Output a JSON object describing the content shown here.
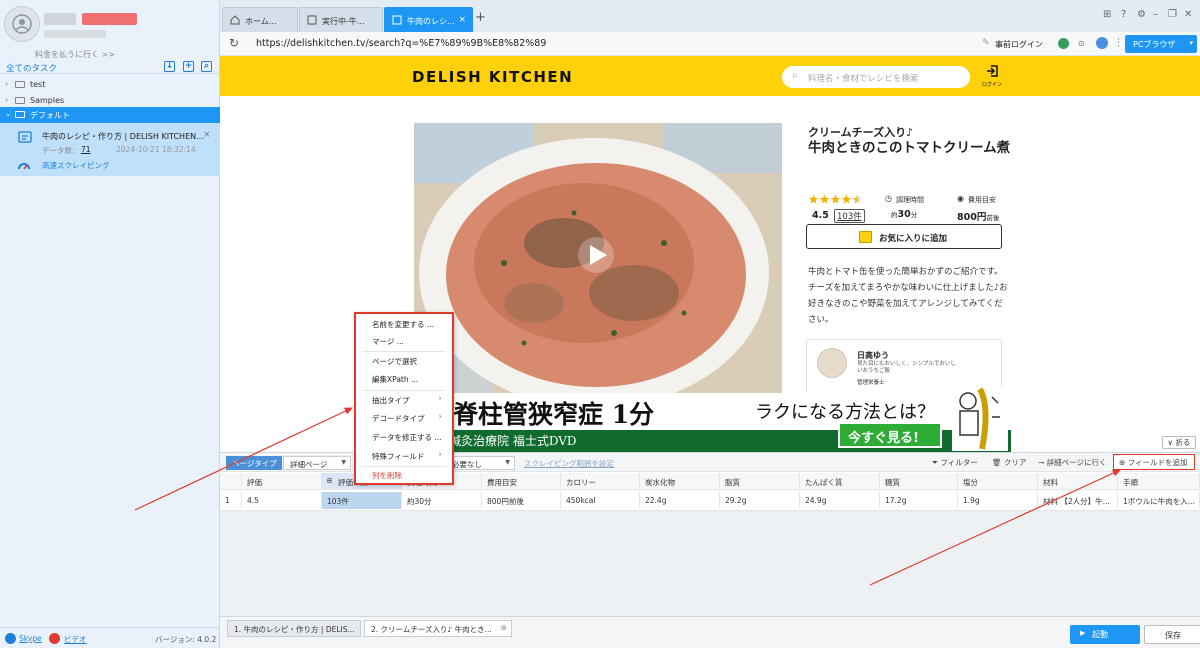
{
  "sidebar": {
    "pay_link": "料金を払うに行く >>",
    "all_tasks": "全てのタスク",
    "folders": [
      {
        "name": "test"
      },
      {
        "name": "Samples"
      },
      {
        "name": "デフォルト"
      }
    ],
    "task": {
      "title": "牛肉のレシピ・作り方 | DELISH KITCHEN...",
      "data_count_label": "データ数:",
      "data_count": "71",
      "date": "2024-10-21 18:32:14",
      "mode": "高速スクレイピング"
    },
    "footer": {
      "skype": "Skype",
      "video": "ビデオ",
      "version": "バージョン: 4.0.2"
    }
  },
  "tabs": [
    {
      "label": "ホーム..."
    },
    {
      "label": "実行中-牛..."
    },
    {
      "label": "牛肉のレシ..."
    }
  ],
  "address": {
    "url": "https://delishkitchen.tv/search?q=%E7%89%9B%E8%82%89",
    "pre_login": "事前ログイン",
    "browser_button": "PCブラウザ"
  },
  "site": {
    "logo": "DELISH KITCHEN",
    "search_placeholder": "料理名・食材でレシピを検索",
    "login_label": "ログイン",
    "recipe_subtitle": "クリームチーズ入り♪",
    "recipe_title": "牛肉ときのこのトマトクリーム煮",
    "rating": "4.5",
    "rating_value": 4.5,
    "rating_count": "103件",
    "cook_time_label": "調理時間",
    "cook_time_prefix": "約",
    "cook_time_value": "30",
    "cook_time_unit": "分",
    "cost_label": "費用目安",
    "cost_value": "800",
    "cost_unit": "円",
    "cost_suffix": "前後",
    "fav_button": "お気に入りに追加",
    "description": "牛肉とトマト缶を使った簡単おかずのご紹介です。チーズを加えてまろやかな味わいに仕上げました♪お好きなきのこや野菜を加えてアレンジしてみてください。",
    "author_name": "日高ゆう",
    "author_desc": "見た目にもおいしく、シンプルでおいしいおうちご飯",
    "author_role": "管理栄養士",
    "fold_button": "折る"
  },
  "ad": {
    "line1": "脊柱管狭窄症 1分",
    "line2": "ラクになる方法とは？",
    "line3": "鍼灸治療院 福士式DVD",
    "cta": "今すぐ見る!"
  },
  "context_menu": {
    "items": [
      {
        "label": "名前を変更する ..."
      },
      {
        "label": "マージ ..."
      },
      {
        "label": "ページで選択"
      },
      {
        "label": "編集XPath ..."
      },
      {
        "label": "抽出タイプ"
      },
      {
        "label": "デコードタイプ"
      },
      {
        "label": "データを修正する ..."
      },
      {
        "label": "特殊フィールド"
      },
      {
        "label": "列を削除"
      }
    ]
  },
  "toolbar": {
    "page_type_label": "ページタイプ",
    "page_type_value": "詳細ページ",
    "no_need_value": "必要なし",
    "range_link": "スクレイピング範囲を設定",
    "filter": "フィルター",
    "clear": "クリア",
    "goto_detail": "詳細ページに行く",
    "add_field": "フィールドを追加"
  },
  "table": {
    "headers": [
      "評価",
      "評価件数",
      "調理時間",
      "費用目安",
      "カロリー",
      "炭水化物",
      "脂質",
      "たんぱく質",
      "糖質",
      "塩分",
      "材料",
      "手順"
    ],
    "rows": [
      [
        "1",
        "4.5",
        "103件",
        "約30分",
        "800円前後",
        "450kcal",
        "22.4g",
        "29.2g",
        "24.9g",
        "17.2g",
        "1.9g",
        "材料 【2人分】牛...",
        "1ボウルに牛肉を入..."
      ]
    ]
  },
  "bottom": {
    "tab1": "1. 牛肉のレシピ・作り方 | DELIS...",
    "tab2": "2. クリームチーズ入り♪ 牛肉とき...",
    "start": "起動",
    "save": "保存"
  },
  "colors": {
    "accent": "#1e96f3",
    "brand_yellow": "#ffd10a",
    "highlight_red": "#e03a2f"
  }
}
